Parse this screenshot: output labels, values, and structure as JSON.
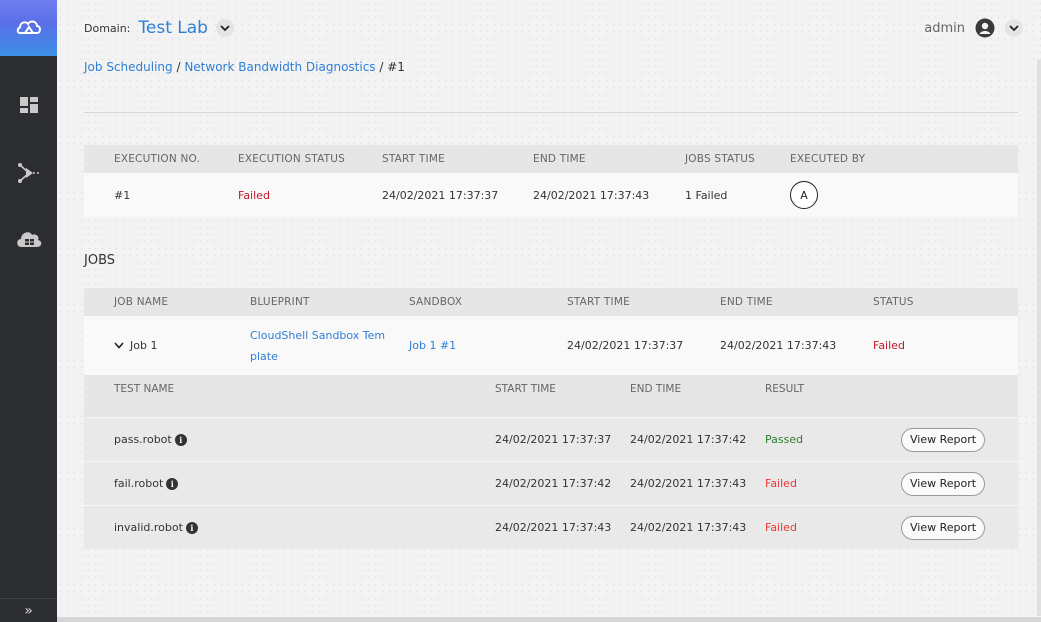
{
  "sidebar": {
    "icons": [
      "logo-icon",
      "dashboard-icon",
      "pipeline-icon",
      "cloud-database-icon"
    ],
    "expand_label": "»"
  },
  "header": {
    "domain_label": "Domain:",
    "domain_value": "Test Lab",
    "user_name": "admin"
  },
  "breadcrumb": {
    "item1": "Job Scheduling",
    "sep1": " / ",
    "item2": "Network Bandwidth Diagnostics",
    "sep2": " / ",
    "item3": "#1"
  },
  "execution": {
    "headers": [
      "EXECUTION NO.",
      "EXECUTION STATUS",
      "START TIME",
      "END TIME",
      "JOBS STATUS",
      "EXECUTED BY"
    ],
    "row": {
      "number": "#1",
      "status": "Failed",
      "start": "24/02/2021 17:37:37",
      "end": "24/02/2021 17:37:43",
      "jobs_status": "1 Failed",
      "executed_by": "A"
    }
  },
  "jobs": {
    "title": "JOBS",
    "headers": [
      "JOB NAME",
      "BLUEPRINT",
      "SANDBOX",
      "START TIME",
      "END TIME",
      "STATUS"
    ],
    "job": {
      "name": "Job 1",
      "blueprint_line1": "CloudShell Sandbox Tem",
      "blueprint_line2": "plate",
      "sandbox": "Job 1 #1",
      "start": "24/02/2021 17:37:37",
      "end": "24/02/2021 17:37:43",
      "status": "Failed"
    },
    "test_headers": [
      "TEST NAME",
      "START TIME",
      "END TIME",
      "RESULT"
    ],
    "tests": [
      {
        "name": "pass.robot",
        "start": "24/02/2021 17:37:37",
        "end": "24/02/2021 17:37:42",
        "result": "Passed",
        "action": "View Report"
      },
      {
        "name": "fail.robot",
        "start": "24/02/2021 17:37:42",
        "end": "24/02/2021 17:37:43",
        "result": "Failed",
        "action": "View Report"
      },
      {
        "name": "invalid.robot",
        "start": "24/02/2021 17:37:43",
        "end": "24/02/2021 17:37:43",
        "result": "Failed",
        "action": "View Report"
      }
    ]
  },
  "colors": {
    "accent": "#2f7fd6",
    "failed": "#c0182b",
    "passed": "#2e7d32",
    "sidebar": "#2b2d31"
  }
}
